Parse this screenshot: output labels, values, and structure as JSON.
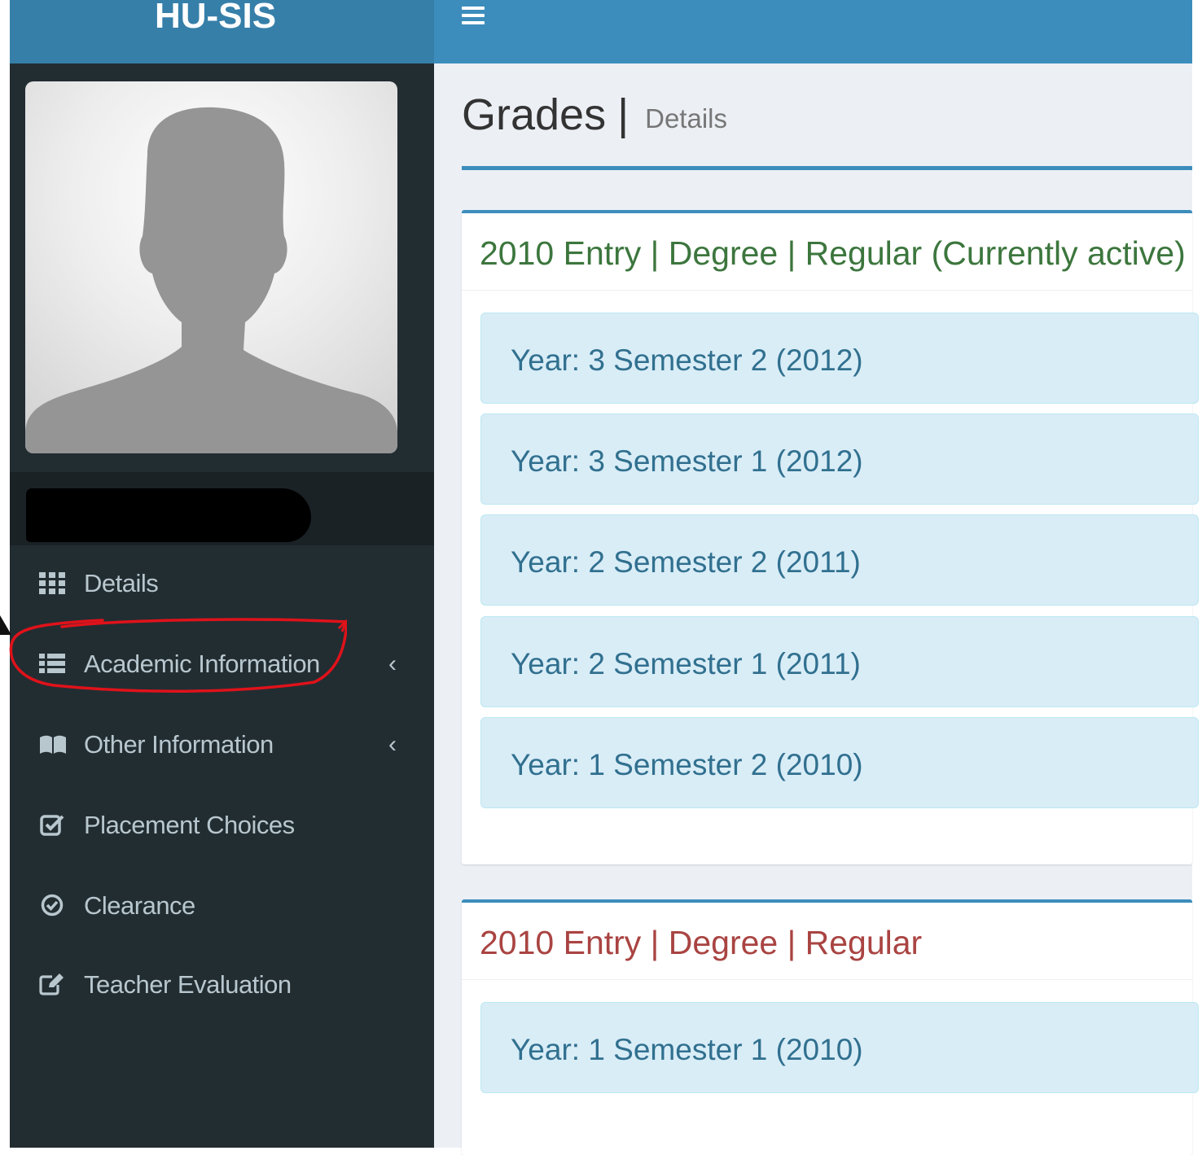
{
  "app": {
    "title": "HU-SIS"
  },
  "page": {
    "title": "Grades",
    "separator": "|",
    "subtitle": "Details"
  },
  "sidebar": {
    "items": [
      {
        "label": "Details",
        "icon": "grid-icon",
        "caret": ""
      },
      {
        "label": "Academic Information",
        "icon": "list-icon",
        "caret": "‹"
      },
      {
        "label": "Other Information",
        "icon": "book-icon",
        "caret": "‹"
      },
      {
        "label": "Placement Choices",
        "icon": "check-square-icon",
        "caret": ""
      },
      {
        "label": "Clearance",
        "icon": "check-circle-icon",
        "caret": ""
      },
      {
        "label": "Teacher Evaluation",
        "icon": "edit-icon",
        "caret": ""
      }
    ]
  },
  "boxes": [
    {
      "title": "2010 Entry | Degree | Regular (Currently active)",
      "color": "#3c763d",
      "semesters": [
        "Year: 3 Semester 2 (2012)",
        "Year: 3 Semester 1 (2012)",
        "Year: 2 Semester 2 (2011)",
        "Year: 2 Semester 1 (2011)",
        "Year: 1 Semester 2 (2010)"
      ]
    },
    {
      "title": "2010 Entry | Degree | Regular",
      "color": "#a94442",
      "semesters": [
        "Year: 1 Semester 1 (2010)"
      ]
    }
  ],
  "colors": {
    "header_primary": "#3c8dbc",
    "header_logo": "#367fa9",
    "sidebar_bg": "#222d32",
    "annotation_ring": "#e0121a"
  }
}
